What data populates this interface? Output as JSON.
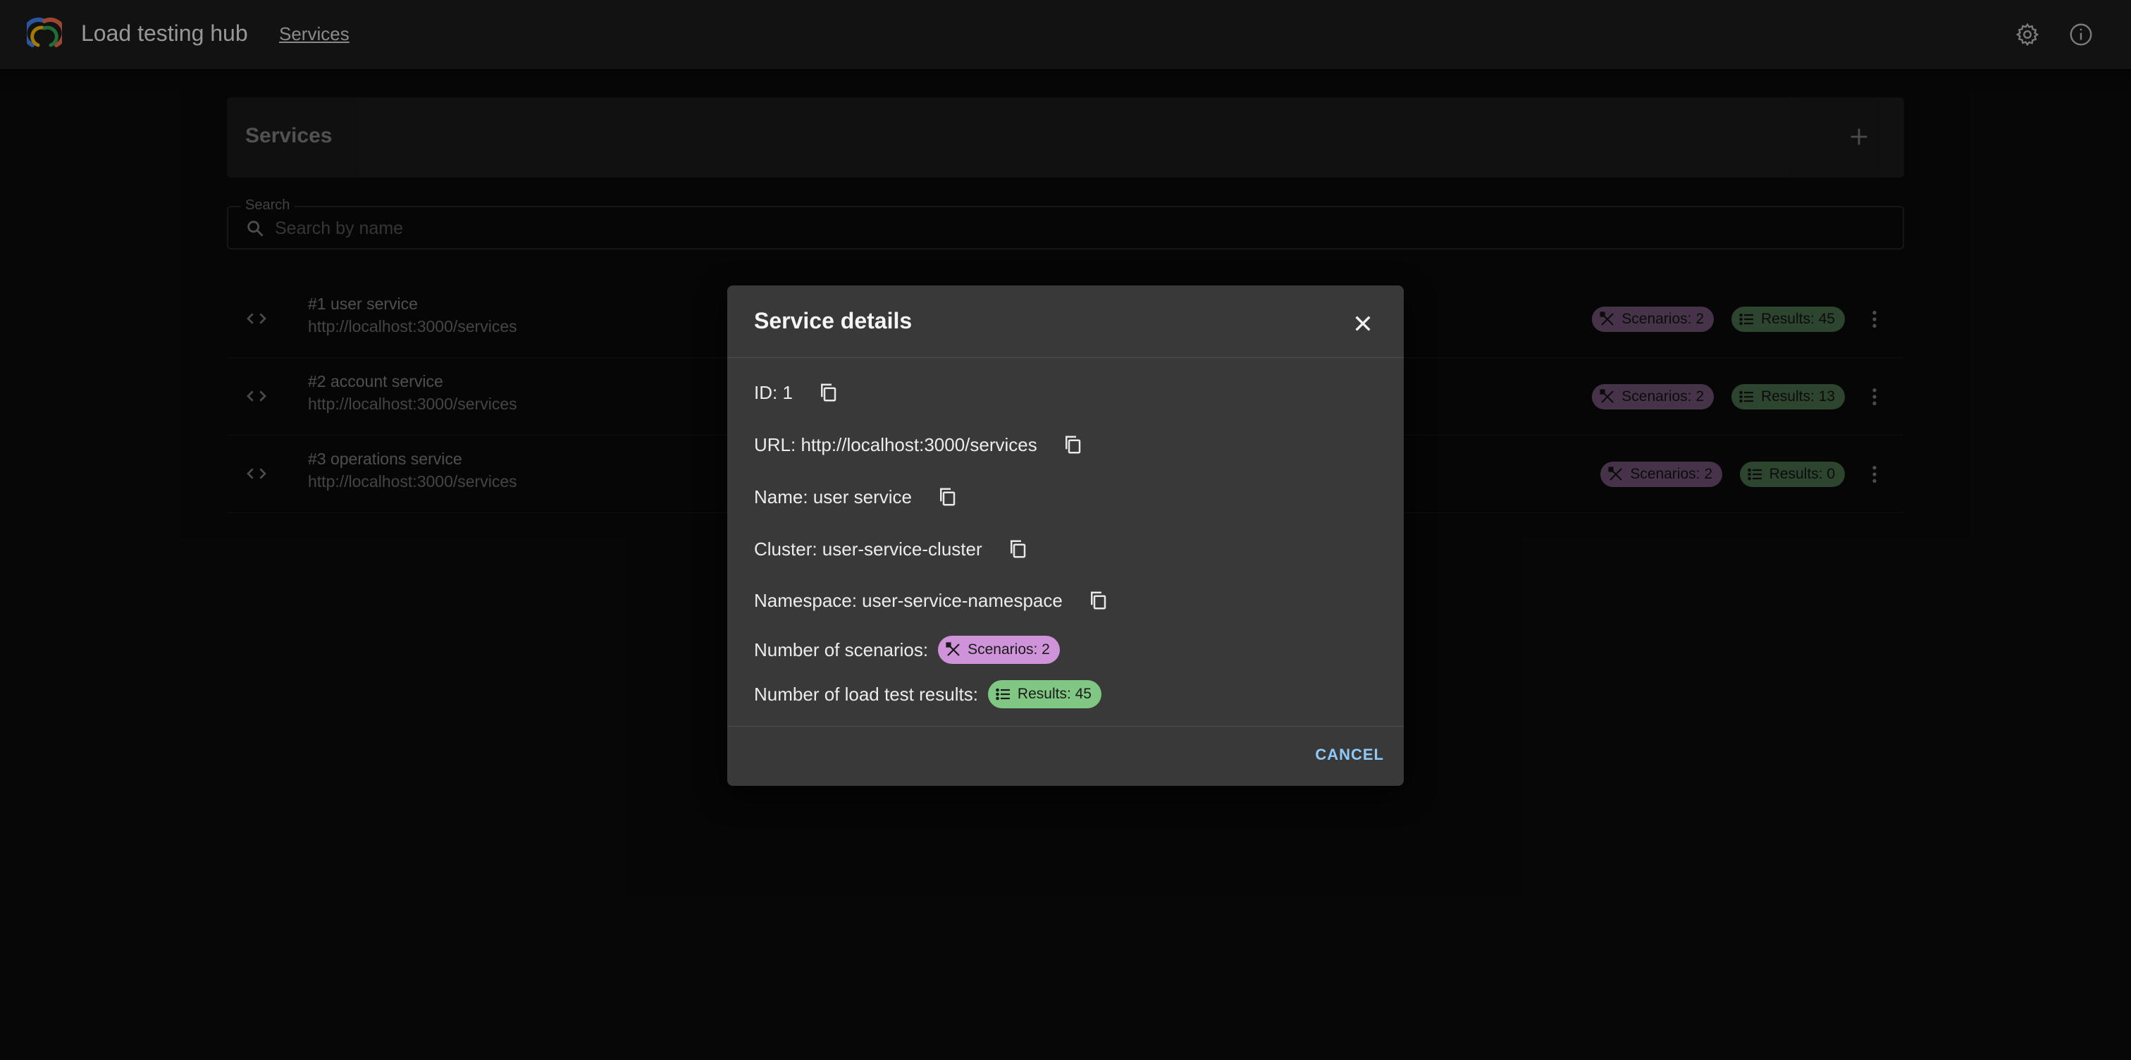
{
  "app": {
    "title": "Load testing hub",
    "nav_link": "Services"
  },
  "services_header": {
    "title": "Services"
  },
  "search": {
    "label": "Search",
    "placeholder": "Search by name",
    "value": ""
  },
  "services": [
    {
      "name": "#1 user service",
      "url": "http://localhost:3000/services",
      "scenarios": "Scenarios: 2",
      "results": "Results: 45"
    },
    {
      "name": "#2 account service",
      "url": "http://localhost:3000/services",
      "scenarios": "Scenarios: 2",
      "results": "Results: 13"
    },
    {
      "name": "#3 operations service",
      "url": "http://localhost:3000/services",
      "scenarios": "Scenarios: 2",
      "results": "Results: 0"
    }
  ],
  "dialog": {
    "title": "Service details",
    "id": "ID: 1",
    "url": "URL: http://localhost:3000/services",
    "name": "Name: user service",
    "cluster": "Cluster: user-service-cluster",
    "namespace": "Namespace: user-service-namespace",
    "scenarios_label": "Number of scenarios:",
    "scenarios_chip": "Scenarios: 2",
    "results_label": "Number of load test results:",
    "results_chip": "Results: 45",
    "cancel": "CANCEL"
  },
  "icons": {
    "settings": "settings-icon",
    "info": "info-icon",
    "add": "plus-icon",
    "search": "search-icon",
    "code": "code-icon",
    "scenarios": "tools-icon",
    "results": "list-icon",
    "more": "more-vert-icon",
    "close": "close-icon",
    "copy": "copy-icon"
  },
  "colors": {
    "appbar": "#1c1c1c",
    "background": "#0a0a0a",
    "dialog": "#393939",
    "scenarios_chip": "#ce93d8",
    "results_chip": "#81c784",
    "primary": "#90caf9"
  }
}
